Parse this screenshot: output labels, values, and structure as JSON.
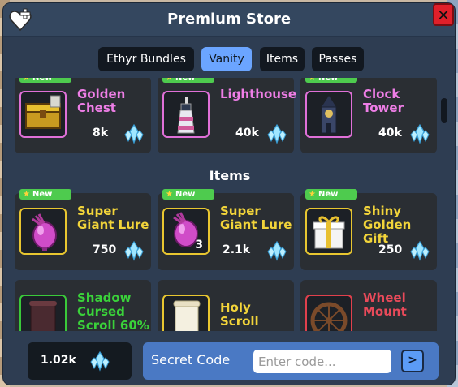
{
  "window": {
    "title": "Premium Store",
    "close_label": "✕"
  },
  "tabs": [
    {
      "label": "Ethyr Bundles",
      "active": false
    },
    {
      "label": "Vanity",
      "active": true
    },
    {
      "label": "Items",
      "active": false
    },
    {
      "label": "Passes",
      "active": false
    }
  ],
  "badge_text": "New",
  "vanity_cards": [
    {
      "name": "Golden Chest",
      "price": "8k",
      "icon": "chest-icon"
    },
    {
      "name": "Lighthouse",
      "price": "40k",
      "icon": "lighthouse-icon"
    },
    {
      "name": "Clock Tower",
      "price": "40k",
      "icon": "clock-tower-icon"
    }
  ],
  "items_section_title": "Items",
  "item_cards": [
    {
      "name": "Super Giant Lure",
      "price": "750",
      "qty": "",
      "icon": "lure-icon"
    },
    {
      "name": "Super Giant Lure",
      "price": "2.1k",
      "qty": "3",
      "icon": "lure-icon"
    },
    {
      "name": "Shiny Golden Gift",
      "price": "250",
      "qty": "",
      "icon": "gift-icon"
    }
  ],
  "bottom_cards": [
    {
      "name": "Shadow Cursed Scroll 60%",
      "icon": "scroll-icon"
    },
    {
      "name": "Holy Scroll",
      "icon": "scroll-icon"
    },
    {
      "name": "Wheel Mount",
      "icon": "wheel-icon"
    }
  ],
  "footer": {
    "balance": "1.02k",
    "code_label": "Secret Code",
    "code_placeholder": "Enter code...",
    "submit_label": ">"
  },
  "colors": {
    "window_bg": "#2e3d52",
    "tab_active": "#6ba5ff",
    "badge_new": "#4ecb4e",
    "vanity_name": "#ee7ee6",
    "item_name": "#f2d43a",
    "close_button": "#e0202a",
    "code_panel": "#4a79c4"
  }
}
